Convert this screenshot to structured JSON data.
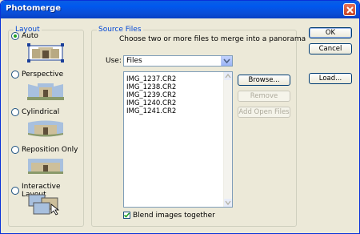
{
  "dialog": {
    "title": "Photomerge"
  },
  "layout": {
    "legend": "Layout",
    "options": [
      {
        "label": "Auto",
        "selected": true
      },
      {
        "label": "Perspective",
        "selected": false
      },
      {
        "label": "Cylindrical",
        "selected": false
      },
      {
        "label": "Reposition Only",
        "selected": false
      },
      {
        "label": "Interactive Layout",
        "selected": false
      }
    ]
  },
  "source": {
    "legend": "Source Files",
    "instruction": "Choose two or more files to merge into a panorama",
    "use_label": "Use:",
    "use_value": "Files",
    "files": [
      "IMG_1237.CR2",
      "IMG_1238.CR2",
      "IMG_1239.CR2",
      "IMG_1240.CR2",
      "IMG_1241.CR2"
    ],
    "browse_label": "Browse...",
    "remove_label": "Remove",
    "add_open_label": "Add Open Files",
    "blend_label": "Blend images together",
    "blend_checked": true
  },
  "actions": {
    "ok": "OK",
    "cancel": "Cancel",
    "load": "Load..."
  },
  "colors": {
    "title_bar": "#0a5ee4",
    "group_legend": "#0046d5",
    "dialog_bg": "#ece9d8"
  }
}
